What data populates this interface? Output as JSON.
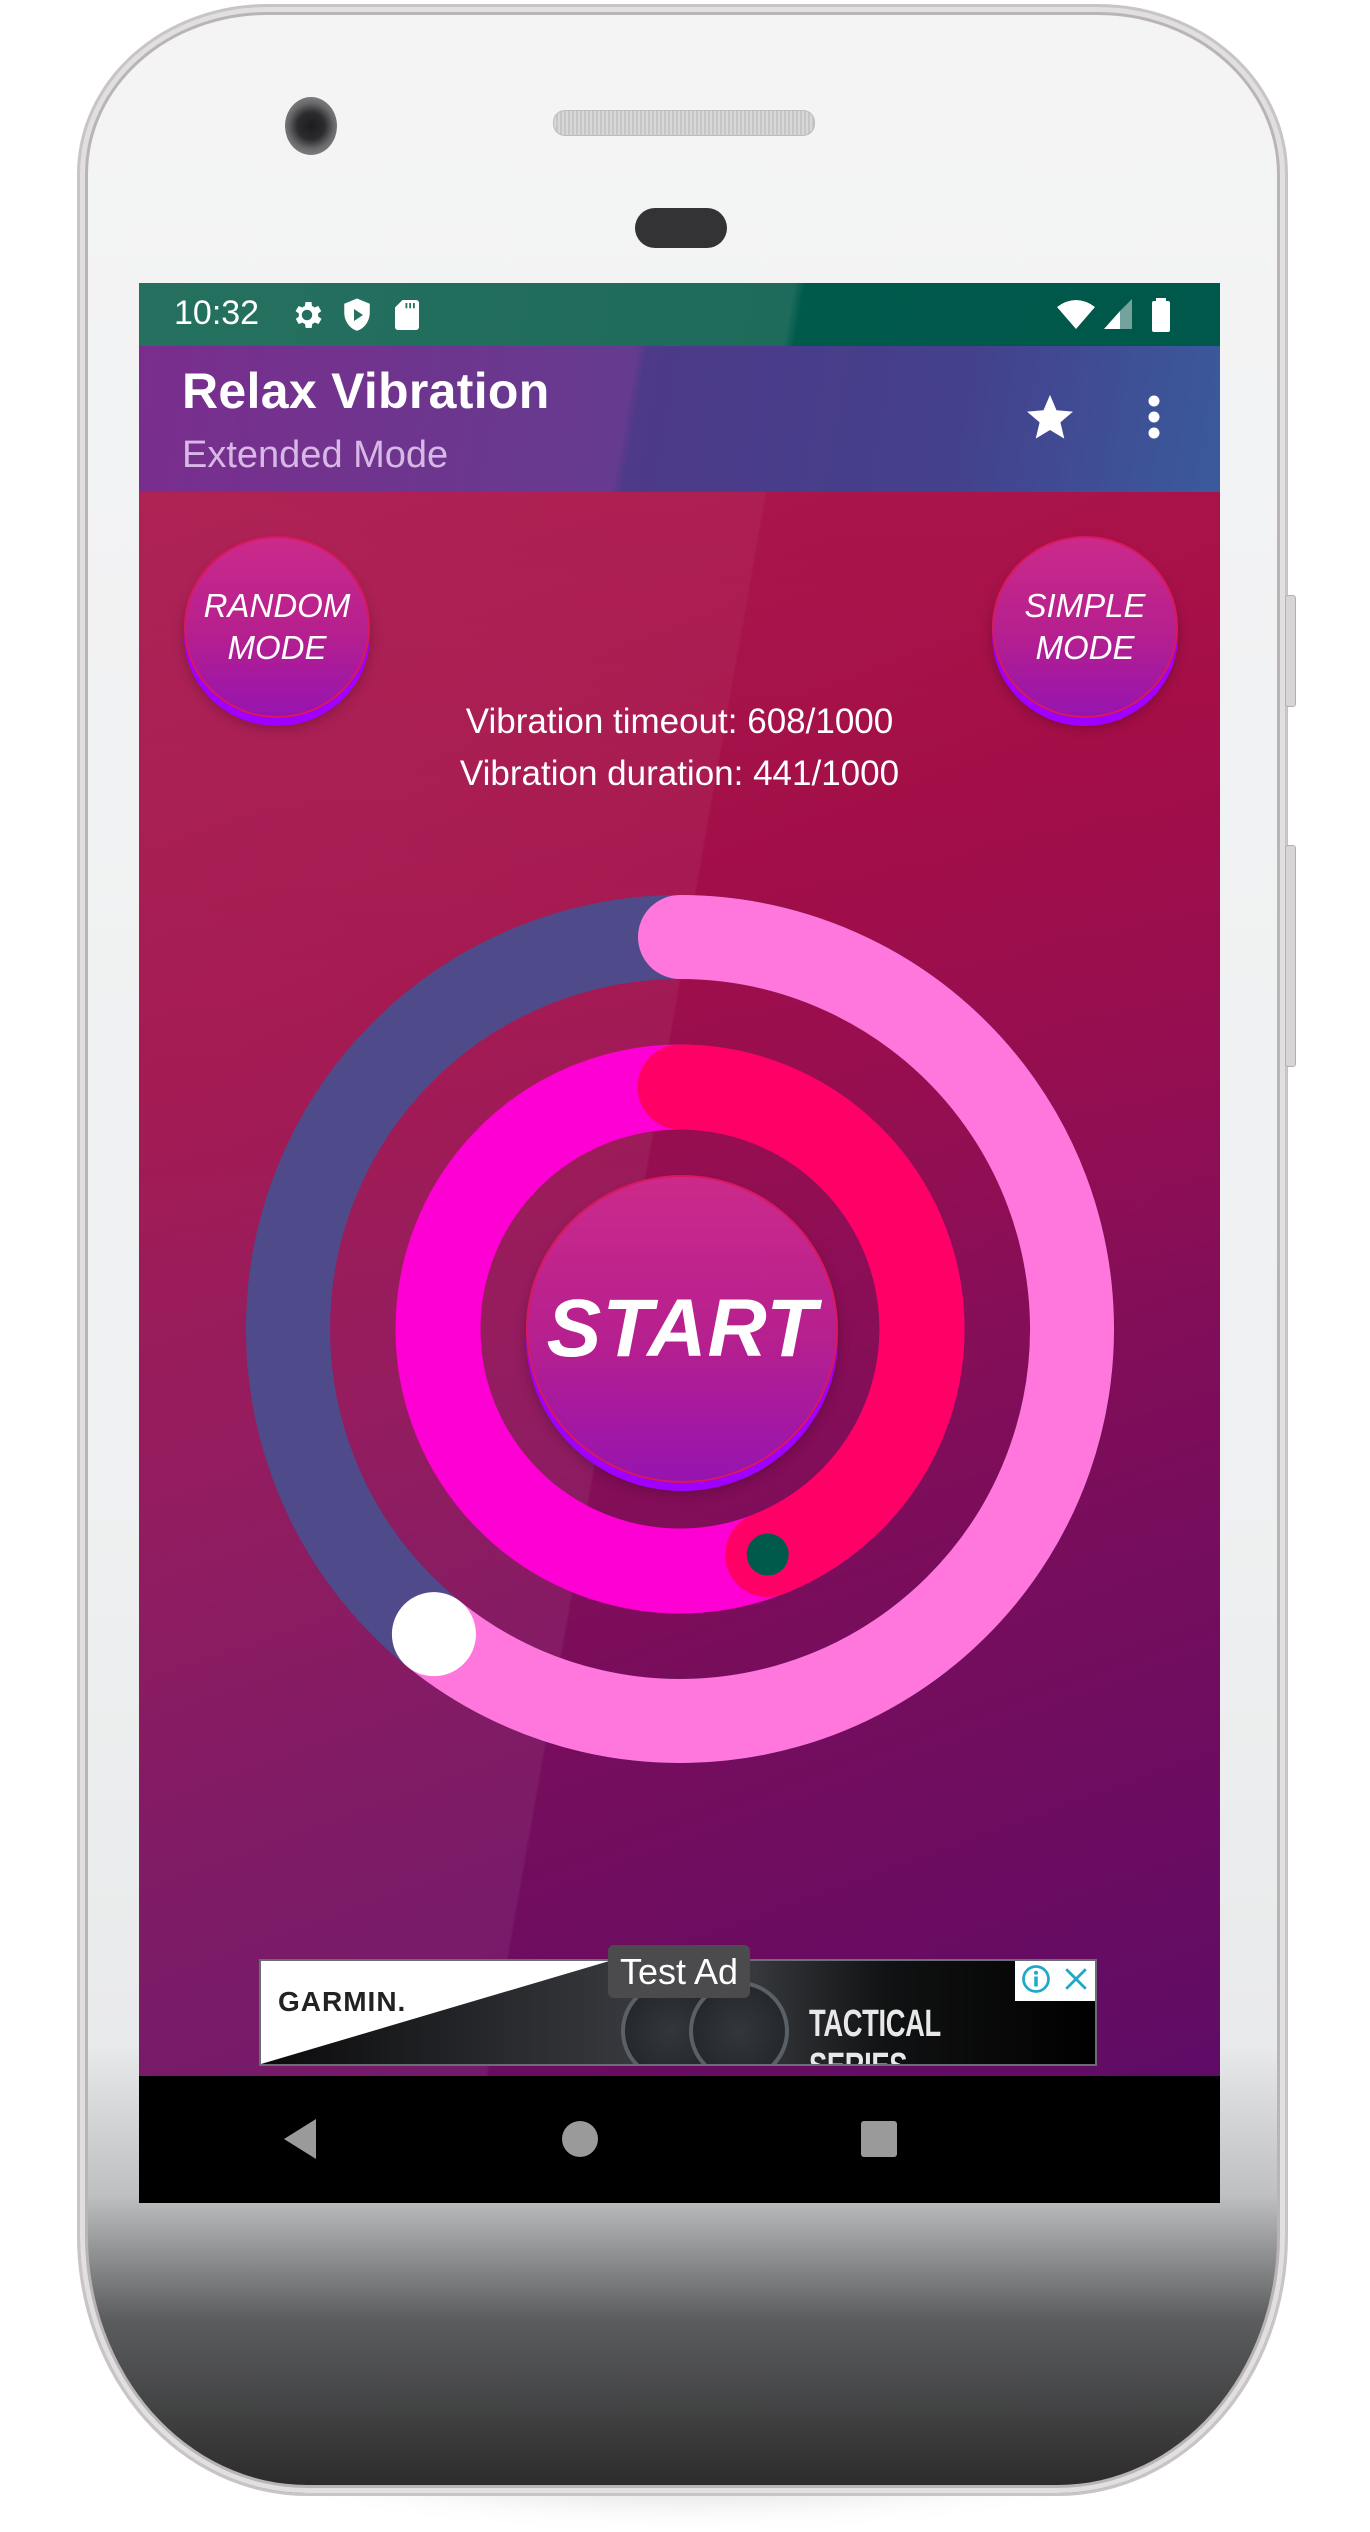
{
  "status_bar": {
    "time": "10:32",
    "left_icons": [
      "gear-icon",
      "shield-play-icon",
      "sd-card-icon"
    ],
    "right_icons": [
      "wifi-icon",
      "cell-signal-icon",
      "battery-icon"
    ]
  },
  "toolbar": {
    "title": "Relax Vibration",
    "subtitle": "Extended Mode",
    "actions": [
      {
        "name": "favorite",
        "icon": "star-icon"
      },
      {
        "name": "more-options",
        "icon": "more-vert-icon"
      }
    ]
  },
  "buttons": {
    "random_mode": "RANDOM\nMODE",
    "simple_mode": "SIMPLE\nMODE",
    "start": "START"
  },
  "info": {
    "timeout_label": "Vibration timeout: 608/1000",
    "duration_label": "Vibration duration: 441/1000"
  },
  "sliders": {
    "timeout": {
      "value": 608,
      "max": 1000,
      "track_color": "#4f4b8a",
      "fill_color": "#ff77dd",
      "thumb_color": "#ffffff"
    },
    "duration": {
      "value": 441,
      "max": 1000,
      "track_color": "#ff00d4",
      "fill_color": "#ff0066",
      "thumb_color": "#005a4c"
    }
  },
  "ad": {
    "label": "Test Ad",
    "brand": "GARMIN.",
    "tagline": "TACTICAL SERIES",
    "choices_icons": [
      "info-icon",
      "close-icon"
    ]
  },
  "nav_bar": {
    "buttons": [
      {
        "name": "back",
        "icon": "back-triangle-icon"
      },
      {
        "name": "home",
        "icon": "home-circle-icon"
      },
      {
        "name": "recents",
        "icon": "recents-square-icon"
      }
    ]
  },
  "colors": {
    "status_bar": "#00574b",
    "accent": "#ff0066",
    "background_top": "#9c0e4b",
    "background_bottom": "#5f0c66"
  }
}
